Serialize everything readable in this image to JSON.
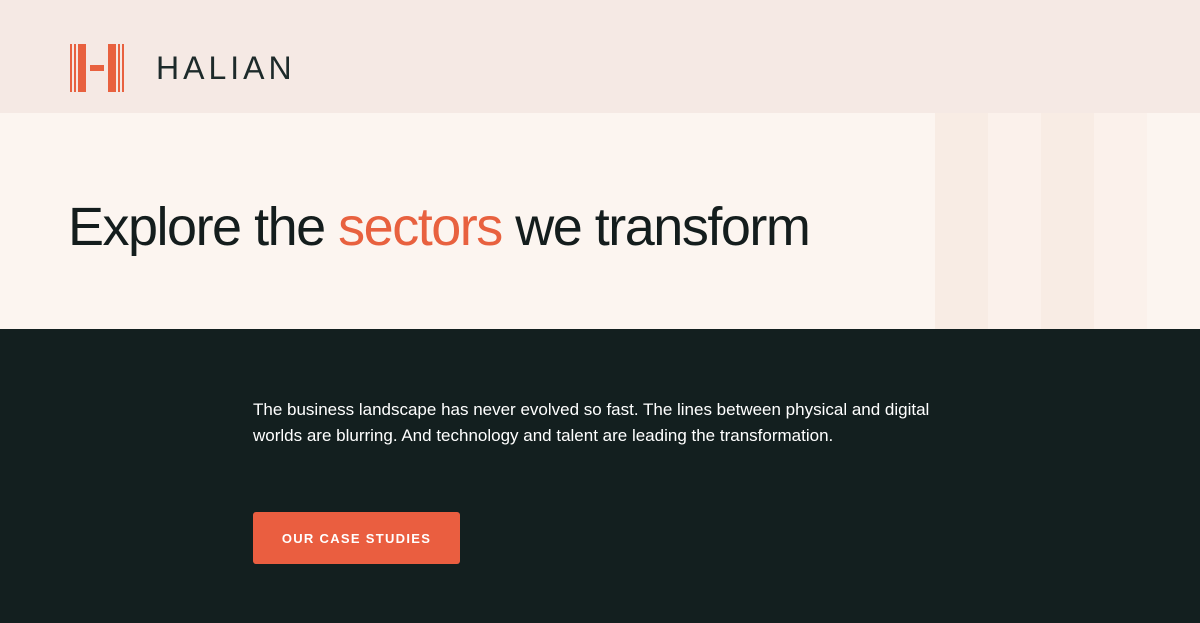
{
  "header": {
    "logo_text": "HALIAN"
  },
  "hero": {
    "headline_before": "Explore the ",
    "headline_accent": "sectors",
    "headline_after": " we transform"
  },
  "section": {
    "intro_text": "The business landscape has never evolved so fast. The lines between physical and digital worlds are blurring. And technology and talent are leading the transformation.",
    "cta_label": "OUR CASE STUDIES"
  },
  "colors": {
    "brand_accent": "#e8613f",
    "header_bg": "#f5e9e4",
    "hero_bg": "#fcf5f0",
    "dark_bg": "#131f1f",
    "button_bg": "#ea5e40"
  },
  "icons": {
    "logo_mark": "halian-h-logo-icon"
  }
}
